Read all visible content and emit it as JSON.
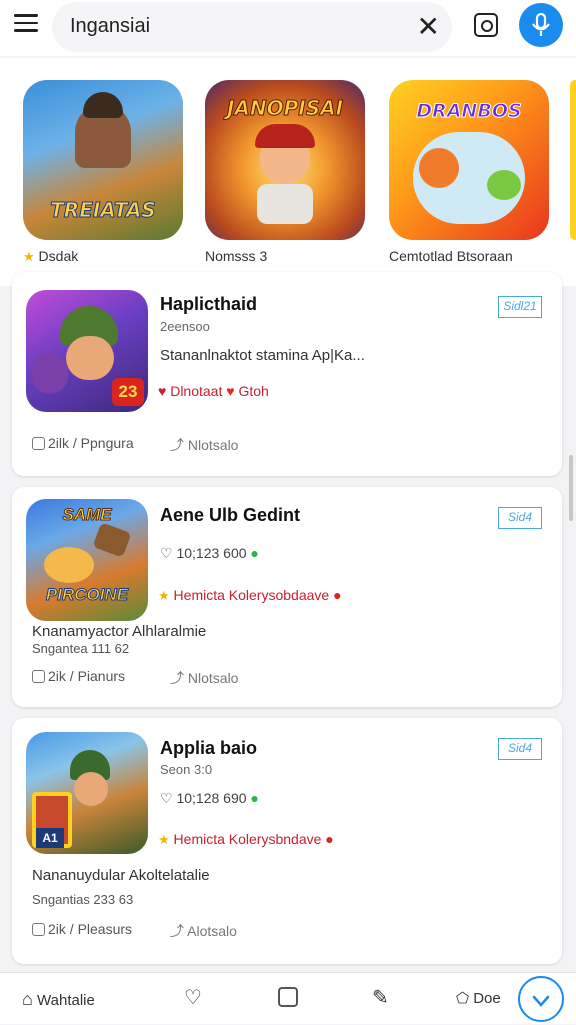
{
  "search": {
    "query": "Ingansiai"
  },
  "featured": [
    {
      "name": "Dsdak",
      "art_title": "TREIATAS",
      "rated": true
    },
    {
      "name": "Nomsss 3",
      "art_title": "JANOPISAI",
      "rated": false
    },
    {
      "name": "Cemtotlad Btsoraan",
      "art_title": "DRANBOS",
      "rated": false
    }
  ],
  "cards": [
    {
      "title": "Haplicthaid",
      "sub": "2eensoo",
      "line": "Stananlnaktot stamina Ap|Ka...",
      "tag1": "Dlnotaat",
      "tag2": "Gtoh",
      "badge": "Sidl21",
      "meta1": "2ilk",
      "meta2": "/ Ppngura",
      "action": "Nlotsalo",
      "icon_text": "23"
    },
    {
      "title": "Aene Ulb Gedint",
      "sub": "10;123 600",
      "tag": "Hemicta  Kolerysobdaave",
      "desc": "Knanamyactor Alhlaralmie",
      "desc2": "Sngantea  111 62",
      "badge": "Sid4",
      "meta1": "2ik",
      "meta2": "/ Pianurs",
      "action": "Nlotsalo",
      "icon_title": "SAME",
      "icon_sub": "PIRCOINE"
    },
    {
      "title": "Applia baio",
      "sub": "Seon 3:0",
      "rating": "10;128 690",
      "tag": "Hemicta  Kolerysbndave",
      "desc": "Nananuydular Akoltelatalie",
      "desc2": "Sngantias  233 63",
      "badge": "Sid4",
      "meta1": "2ik",
      "meta2": "/ Pleasurs",
      "action": "Alotsalo",
      "icon_text": "A1"
    }
  ],
  "nav": {
    "home_label": "Wahtalie",
    "more_label": "Doe"
  },
  "colors": {
    "accent": "#1a8cf0",
    "tag": "#c8202f",
    "badge": "#4aa8e8"
  }
}
